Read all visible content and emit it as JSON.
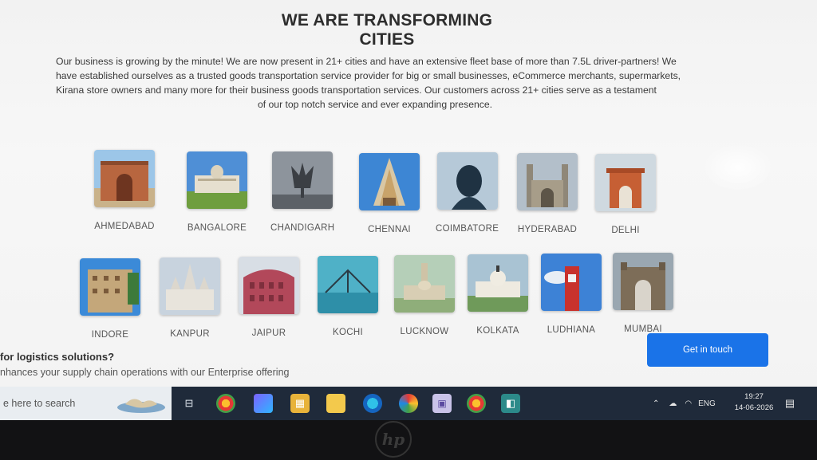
{
  "section": {
    "heading": "WE ARE TRANSFORMING CITIES",
    "intro_lines": [
      "Our business is growing by the minute! We are now present in 21+ cities and have an extensive fleet base of more than 7.5L driver-partners! We",
      "have established ourselves as a trusted goods transportation service provider for big or small businesses, eCommerce merchants, supermarkets,",
      "Kirana store owners and many more for their business goods transportation services. Our customers across 21+ cities serve as a testament",
      "of our top notch service and ever expanding presence."
    ]
  },
  "cities_row1": [
    {
      "name": "AHMEDABAD",
      "icon": "ahmedabad-landmark-icon"
    },
    {
      "name": "BANGALORE",
      "icon": "bangalore-landmark-icon"
    },
    {
      "name": "CHANDIGARH",
      "icon": "chandigarh-landmark-icon"
    },
    {
      "name": "CHENNAI",
      "icon": "chennai-landmark-icon"
    },
    {
      "name": "COIMBATORE",
      "icon": "coimbatore-landmark-icon"
    },
    {
      "name": "HYDERABAD",
      "icon": "hyderabad-landmark-icon"
    },
    {
      "name": "DELHI",
      "icon": "delhi-landmark-icon"
    }
  ],
  "cities_row2": [
    {
      "name": "INDORE",
      "icon": "indore-landmark-icon"
    },
    {
      "name": "KANPUR",
      "icon": "kanpur-landmark-icon"
    },
    {
      "name": "JAIPUR",
      "icon": "jaipur-landmark-icon"
    },
    {
      "name": "KOCHI",
      "icon": "kochi-landmark-icon"
    },
    {
      "name": "LUCKNOW",
      "icon": "lucknow-landmark-icon"
    },
    {
      "name": "KOLKATA",
      "icon": "kolkata-landmark-icon"
    },
    {
      "name": "LUDHIANA",
      "icon": "ludhiana-landmark-icon"
    },
    {
      "name": "MUMBAI",
      "icon": "mumbai-landmark-icon"
    }
  ],
  "enterprise": {
    "title": "for logistics solutions?",
    "subtitle": "nhances your supply chain operations with our Enterprise offering",
    "cta_label": "Get in touch"
  },
  "taskbar": {
    "search_placeholder": "e here to search",
    "tray_lang": "ENG",
    "time": "19:27",
    "date": "14-06-2026"
  },
  "device": {
    "logo_text": "hp"
  },
  "colors": {
    "cta": "#1a73e8",
    "taskbar": "#1f2a3a"
  }
}
